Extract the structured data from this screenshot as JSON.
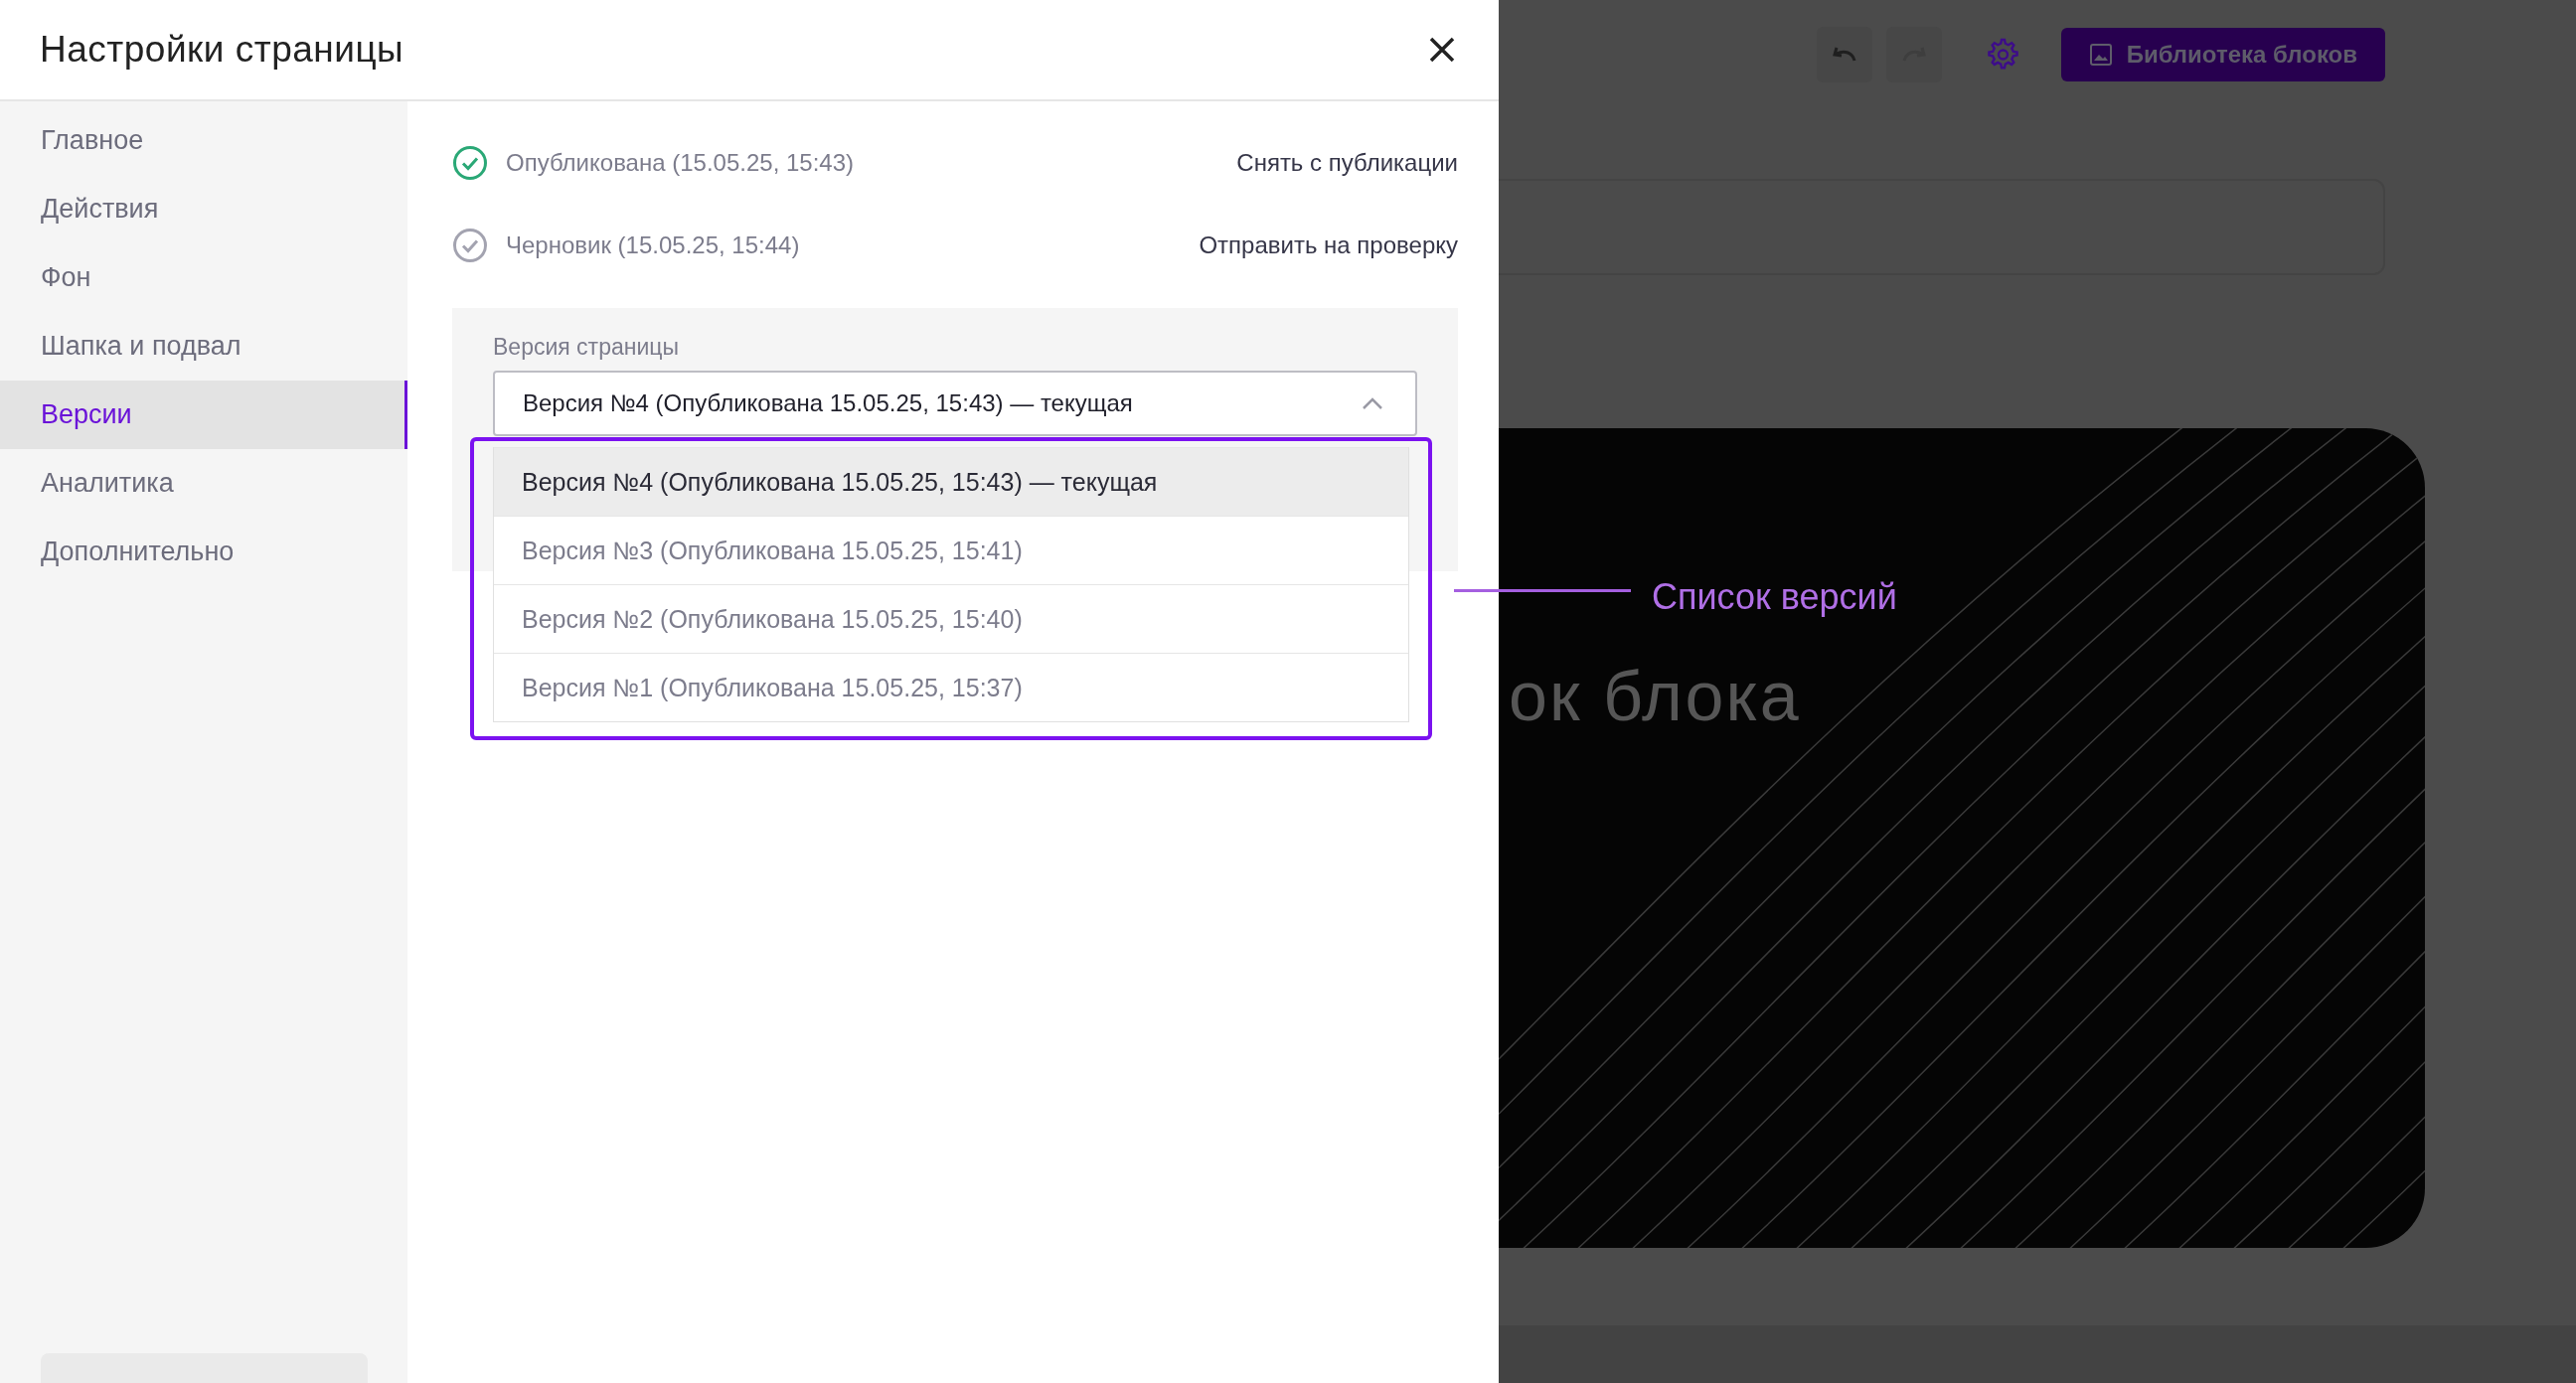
{
  "dialog": {
    "title": "Настройки страницы"
  },
  "sidebar": {
    "items": [
      {
        "label": "Главное",
        "selected": false
      },
      {
        "label": "Действия",
        "selected": false
      },
      {
        "label": "Фон",
        "selected": false
      },
      {
        "label": "Шапка и подвал",
        "selected": false
      },
      {
        "label": "Версии",
        "selected": true
      },
      {
        "label": "Аналитика",
        "selected": false
      },
      {
        "label": "Дополнительно",
        "selected": false
      }
    ]
  },
  "statuses": [
    {
      "kind": "published",
      "label": "Опубликована (15.05.25, 15:43)",
      "action": "Снять с публикации"
    },
    {
      "kind": "draft",
      "label": "Черновик (15.05.25, 15:44)",
      "action": "Отправить на проверку"
    }
  ],
  "version_select": {
    "label": "Версия страницы",
    "value": "Версия №4 (Опубликована 15.05.25, 15:43) — текущая",
    "expanded": true,
    "options": [
      {
        "label": "Версия №4 (Опубликована 15.05.25, 15:43) — текущая",
        "selected": true
      },
      {
        "label": "Версия №3 (Опубликована 15.05.25, 15:41)",
        "selected": false
      },
      {
        "label": "Версия №2 (Опубликована 15.05.25, 15:40)",
        "selected": false
      },
      {
        "label": "Версия №1 (Опубликована 15.05.25, 15:37)",
        "selected": false
      }
    ]
  },
  "annotation": {
    "text": "Список версий"
  },
  "editor": {
    "toolbar": [
      {
        "kind": "undo",
        "disabled": false
      },
      {
        "kind": "redo",
        "disabled": true
      },
      {
        "kind": "settings",
        "disabled": false
      }
    ],
    "library_button": "Библиотека блоков",
    "block_title": "ок блока"
  }
}
